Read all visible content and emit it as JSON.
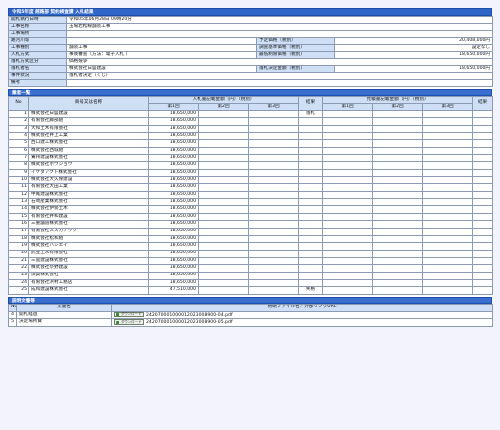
{
  "title": "令和5年度 越路部 契約検査課 入札結果",
  "info": {
    "date_label": "開札執行日時",
    "date_value": "令和05年06月28日 09時20分",
    "name_label": "工事名称",
    "name_value": "玉場若松線舗装工事",
    "place_label": "工事場所",
    "place_value": "",
    "period_label": "路河川等",
    "period_value": "",
    "estimate_label": "予定価格（税別）",
    "estimate_value": "20,408,000円",
    "type_label": "工事種別",
    "type_value": "舗装工事",
    "survey_label": "調査基準価格（税別）",
    "survey_value": "設定なし",
    "method_label": "入札方式",
    "method_value": "事後審査（方法：電子入札 ）",
    "min_label": "最低制限価格（税別）",
    "min_value": "18,650,000円",
    "decision_label": "落札方式区分",
    "decision_value": "価格競争",
    "winner_label": "落札者名",
    "winner_value": "株式会社日盛建設",
    "winprice_label": "落札決定金額（税別）",
    "winprice_value": "18,650,000円",
    "status_label": "事件状況",
    "status_value": "落札者決定（くじ）",
    "remarks_label": "備考",
    "remarks_value": ""
  },
  "bidders": {
    "section_title": "業者一覧",
    "h_no": "No",
    "h_name": "商号又は名称",
    "h_bid": "入札書記載金額（円）（税別）",
    "h_result": "結果",
    "h_rebid": "見積書記載金額（円）（税別）",
    "h_result2": "結果",
    "h_r1": "第1回",
    "h_r2": "第2回",
    "h_r3": "第3回",
    "h_q1": "第1回",
    "h_q2": "第2回",
    "h_q3": "第3回",
    "rows": [
      {
        "no": "1",
        "name": "株式会社日盛建設",
        "r1": "18,650,000",
        "result": "落札"
      },
      {
        "no": "2",
        "name": "有限会社藤部組",
        "r1": "18,650,000",
        "result": ""
      },
      {
        "no": "3",
        "name": "大和土木有限会社",
        "r1": "18,650,000",
        "result": ""
      },
      {
        "no": "4",
        "name": "株式会社井上工業",
        "r1": "18,650,000",
        "result": ""
      },
      {
        "no": "5",
        "name": "西口建工株式会社",
        "r1": "18,650,000",
        "result": ""
      },
      {
        "no": "6",
        "name": "株式会社西城組",
        "r1": "18,650,000",
        "result": ""
      },
      {
        "no": "7",
        "name": "鷲州建設株式会社",
        "r1": "18,650,000",
        "result": ""
      },
      {
        "no": "8",
        "name": "株式会社ホウジョウ",
        "r1": "18,650,000",
        "result": ""
      },
      {
        "no": "9",
        "name": "イケダアクト株式会社",
        "r1": "18,650,000",
        "result": ""
      },
      {
        "no": "10",
        "name": "株式会社大久保建設",
        "r1": "18,650,000",
        "result": ""
      },
      {
        "no": "11",
        "name": "有限会社大田工業",
        "r1": "18,650,000",
        "result": ""
      },
      {
        "no": "12",
        "name": "中尾建設株式会社",
        "r1": "18,650,000",
        "result": ""
      },
      {
        "no": "13",
        "name": "石崎産業株式会社",
        "r1": "18,650,000",
        "result": ""
      },
      {
        "no": "14",
        "name": "株式会社伊勢土木",
        "r1": "18,650,000",
        "result": ""
      },
      {
        "no": "15",
        "name": "有限会社井和建設",
        "r1": "18,650,000",
        "result": ""
      },
      {
        "no": "16",
        "name": "三重舗道株式会社",
        "r1": "18,650,000",
        "result": ""
      },
      {
        "no": "17",
        "name": "有限会社スズカテック",
        "r1": "18,650,000",
        "result": ""
      },
      {
        "no": "18",
        "name": "株式会社松和組",
        "r1": "18,650,000",
        "result": ""
      },
      {
        "no": "19",
        "name": "株式会社ハシエイ",
        "r1": "18,650,000",
        "result": ""
      },
      {
        "no": "20",
        "name": "武笠土木有限会社",
        "r1": "18,650,000",
        "result": ""
      },
      {
        "no": "21",
        "name": "三雲建設株式会社",
        "r1": "18,650,000",
        "result": ""
      },
      {
        "no": "22",
        "name": "株式会社奈野建設",
        "r1": "18,650,000",
        "result": ""
      },
      {
        "no": "23",
        "name": "須賀株式会社",
        "r1": "18,650,000",
        "result": ""
      },
      {
        "no": "24",
        "name": "有限会社浜村工務店",
        "r1": "18,650,000",
        "result": ""
      },
      {
        "no": "25",
        "name": "成和建設株式会社",
        "r1": "47,510,000",
        "result": "失格"
      }
    ]
  },
  "docs": {
    "section_title": "説明文書等",
    "h_no": "No",
    "h_name": "文書名",
    "h_file": "格納ファイル名／外部リンクURL",
    "download_label": "ダウンロード",
    "rows": [
      {
        "no": "4",
        "name": "開札経過",
        "file": "242070001000012023008900-04.pdf"
      },
      {
        "no": "5",
        "name": "決定場所費",
        "file": "242070001000012023008900-05.pdf"
      }
    ]
  },
  "colors": {
    "header_bar": "#2f66c8",
    "label_bg": "#cfe0f6",
    "page_bg": "#f3f4fb",
    "download_icon": "#3f8f3a"
  }
}
